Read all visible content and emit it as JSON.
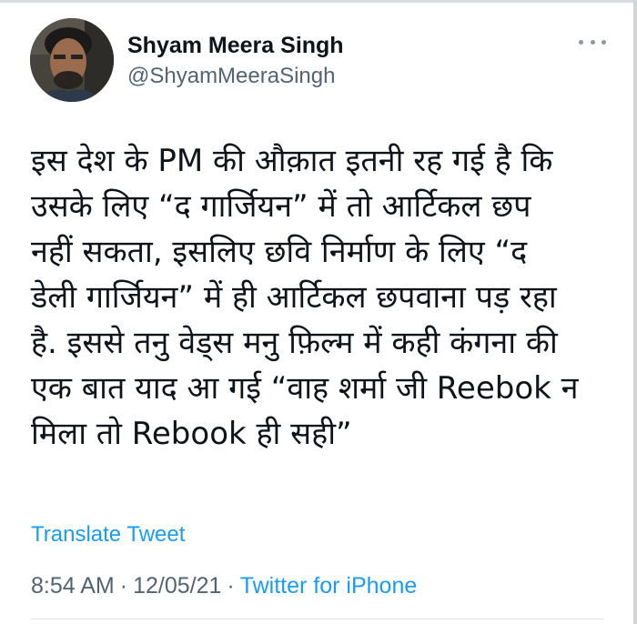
{
  "author": {
    "display_name": "Shyam Meera Singh",
    "handle": "@ShyamMeeraSingh"
  },
  "tweet": {
    "lines": [
      "इस देश के PM की औक़ात इतनी रह गई है कि",
      "उसके लिए “द गार्जियन” में तो आर्टिकल छप",
      "नहीं सकता, इसलिए छवि निर्माण के लिए “द",
      "डेली गार्जियन” में ही आर्टिकल छपवाना पड़ रहा",
      "है. इससे तनु वेड्स मनु फ़िल्म में कही कंगना की",
      "एक बात याद आ गई “वाह शर्मा जी Reebok न",
      "मिला तो Rebook ही सही”"
    ],
    "translate_label": "Translate Tweet",
    "time": "8:54 AM",
    "separator": "·",
    "date": "12/05/21",
    "source": "Twitter for iPhone"
  },
  "icons": {
    "more": "more-horizontal-icon"
  },
  "colors": {
    "link": "#1d9bf0",
    "secondary_text": "#536471",
    "primary_text": "#0f1419"
  }
}
